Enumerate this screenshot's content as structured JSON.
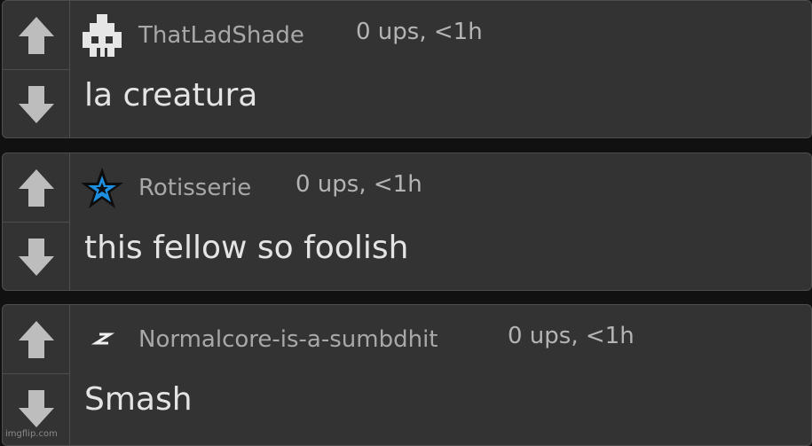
{
  "comments": [
    {
      "username": "ThatLadShade",
      "meta": "0 ups, <1h",
      "text": "la creatura",
      "avatar_icon": "pixel-ghost-icon"
    },
    {
      "username": "Rotisserie",
      "meta": "0 ups, <1h",
      "text": "this fellow so foolish",
      "avatar_icon": "blue-star-icon"
    },
    {
      "username": "Normalcore-is-a-sumbdhit",
      "meta": "0 ups, <1h",
      "text": "Smash",
      "avatar_icon": "lightning-icon"
    }
  ],
  "watermark": "imgflip.com",
  "colors": {
    "card_bg": "#333333",
    "border": "#4e4e4e",
    "arrow": "#bdbdbd",
    "star": "#1e8fe0"
  }
}
